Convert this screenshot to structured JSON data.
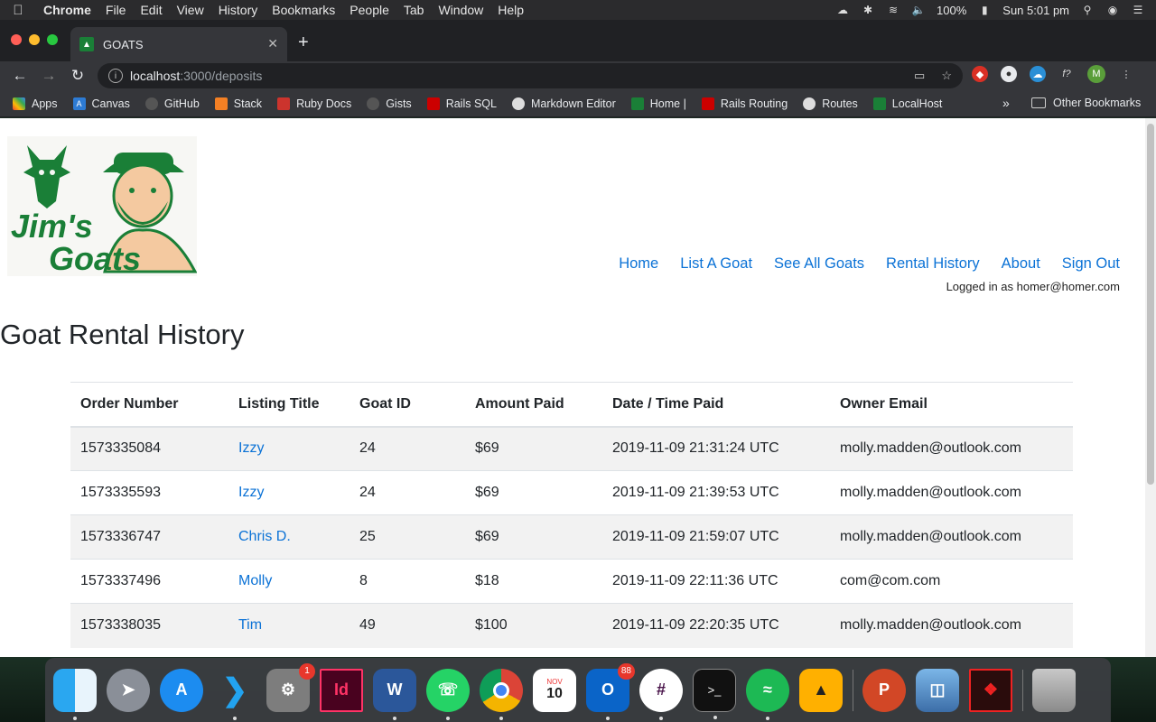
{
  "menubar": {
    "app_name": "Chrome",
    "items": [
      "File",
      "Edit",
      "View",
      "History",
      "Bookmarks",
      "People",
      "Tab",
      "Window",
      "Help"
    ],
    "battery": "100%",
    "clock": "Sun 5:01 pm"
  },
  "tab": {
    "title": "GOATS"
  },
  "address_bar": {
    "host": "localhost",
    "path": ":3000/deposits"
  },
  "bookmarks": {
    "items": [
      "Apps",
      "Canvas",
      "GitHub",
      "Stack",
      "Ruby Docs",
      "Gists",
      "Rails SQL",
      "Markdown Editor",
      "Home |",
      "Rails Routing",
      "Routes",
      "LocalHost"
    ],
    "more": "»",
    "other": "Other Bookmarks"
  },
  "site": {
    "nav": [
      "Home",
      "List A Goat",
      "See All Goats",
      "Rental History",
      "About",
      "Sign Out"
    ],
    "logged_in": "Logged in as homer@homer.com",
    "logo_text": [
      "Jim's",
      "Goats"
    ],
    "page_title": "Goat Rental History"
  },
  "table": {
    "headers": [
      "Order Number",
      "Listing Title",
      "Goat ID",
      "Amount Paid",
      "Date / Time Paid",
      "Owner Email"
    ],
    "rows": [
      [
        "1573335084",
        "Izzy",
        "24",
        "$69",
        "2019-11-09 21:31:24 UTC",
        "molly.madden@outlook.com"
      ],
      [
        "1573335593",
        "Izzy",
        "24",
        "$69",
        "2019-11-09 21:39:53 UTC",
        "molly.madden@outlook.com"
      ],
      [
        "1573336747",
        "Chris D.",
        "25",
        "$69",
        "2019-11-09 21:59:07 UTC",
        "molly.madden@outlook.com"
      ],
      [
        "1573337496",
        "Molly",
        "8",
        "$18",
        "2019-11-09 22:11:36 UTC",
        "com@com.com"
      ],
      [
        "1573338035",
        "Tim",
        "49",
        "$100",
        "2019-11-09 22:20:35 UTC",
        "molly.madden@outlook.com"
      ]
    ]
  },
  "dock": {
    "calendar": {
      "month": "NOV",
      "day": "10"
    },
    "badges": {
      "system_preferences": "1",
      "outlook": "88"
    }
  },
  "colors": {
    "link": "#0b72d6",
    "goat_green": "#1a7f37"
  }
}
